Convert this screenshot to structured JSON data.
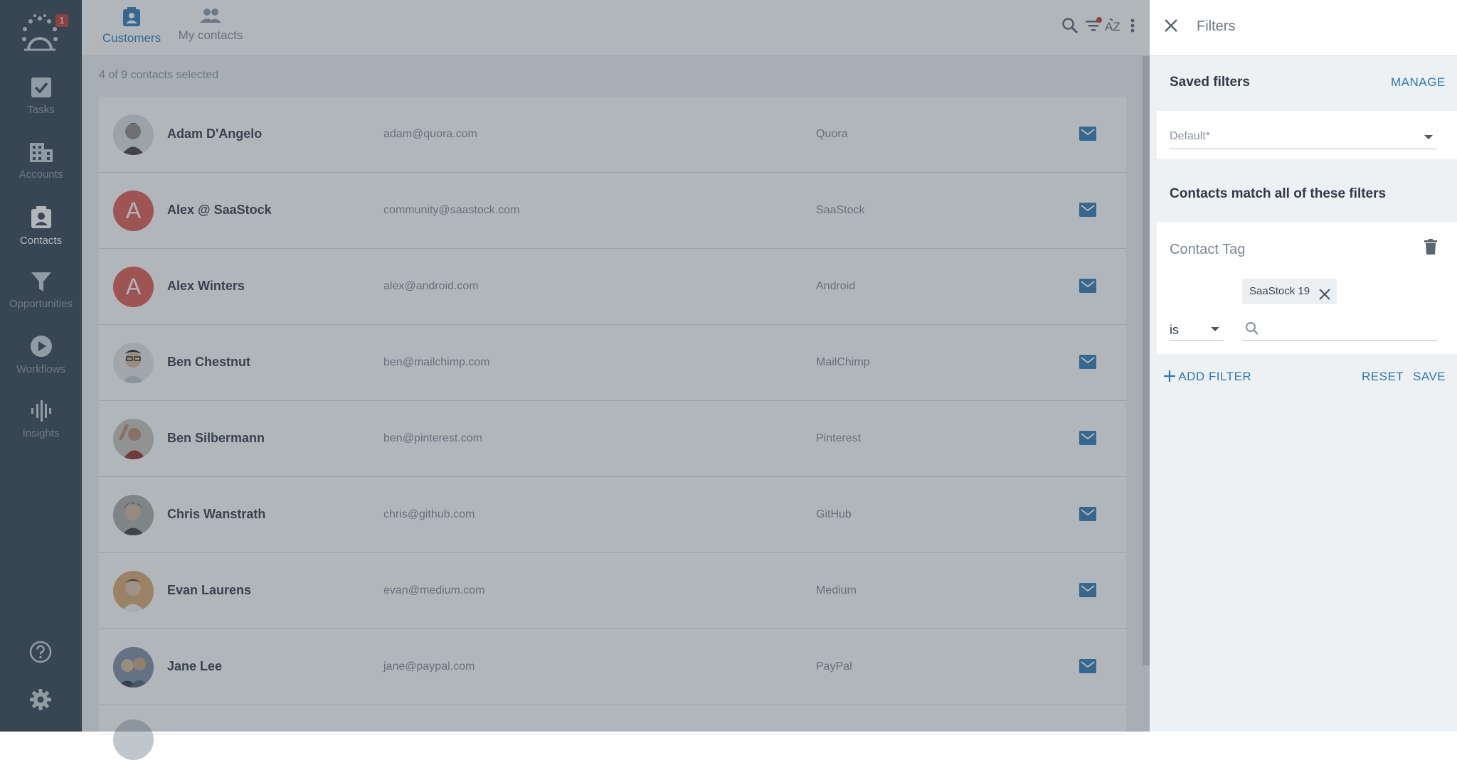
{
  "sidebar": {
    "notification_count": "1",
    "items": [
      {
        "label": "Tasks",
        "icon": "checkbox-icon"
      },
      {
        "label": "Accounts",
        "icon": "building-icon"
      },
      {
        "label": "Contacts",
        "icon": "contact-card-icon",
        "active": true
      },
      {
        "label": "Opportunities",
        "icon": "funnel-icon"
      },
      {
        "label": "Workflows",
        "icon": "play-circle-icon"
      },
      {
        "label": "Insights",
        "icon": "waveform-icon"
      }
    ],
    "bottom": [
      "help-icon",
      "gear-icon"
    ]
  },
  "tabs": [
    {
      "label": "Customers",
      "active": true
    },
    {
      "label": "My contacts",
      "active": false
    }
  ],
  "toolbar_icons": [
    "search-icon",
    "filter-icon",
    "sort-az-icon",
    "more-vert-icon"
  ],
  "selected_text": "4 of 9 contacts selected",
  "contacts": [
    {
      "name": "Adam D'Angelo",
      "email": "adam@quora.com",
      "company": "Quora",
      "avatar": "photo"
    },
    {
      "name": "Alex @ SaaStock",
      "email": "community@saastock.com",
      "company": "SaaStock",
      "avatar": "A"
    },
    {
      "name": "Alex Winters",
      "email": "alex@android.com",
      "company": "Android",
      "avatar": "A"
    },
    {
      "name": "Ben Chestnut",
      "email": "ben@mailchimp.com",
      "company": "MailChimp",
      "avatar": "photo"
    },
    {
      "name": "Ben Silbermann",
      "email": "ben@pinterest.com",
      "company": "Pinterest",
      "avatar": "photo"
    },
    {
      "name": "Chris Wanstrath",
      "email": "chris@github.com",
      "company": "GitHub",
      "avatar": "photo"
    },
    {
      "name": "Evan Laurens",
      "email": "evan@medium.com",
      "company": "Medium",
      "avatar": "photo"
    },
    {
      "name": "Jane Lee",
      "email": "jane@paypal.com",
      "company": "PayPal",
      "avatar": "photo"
    }
  ],
  "filters": {
    "title": "Filters",
    "saved_filters_label": "Saved filters",
    "manage_label": "MANAGE",
    "saved_filter_value": "Default*",
    "match_label": "Contacts match all of these filters",
    "filter_name": "Contact Tag",
    "chip_label": "SaaStock 19",
    "operator": "is",
    "add_filter_label": "ADD FILTER",
    "reset_label": "RESET",
    "save_label": "SAVE"
  },
  "colors": {
    "sidebar_bg": "#2f3e4f",
    "accent": "#2b78b4",
    "avatar_letter_bg": "#e0564f",
    "badge": "#c0392b"
  }
}
